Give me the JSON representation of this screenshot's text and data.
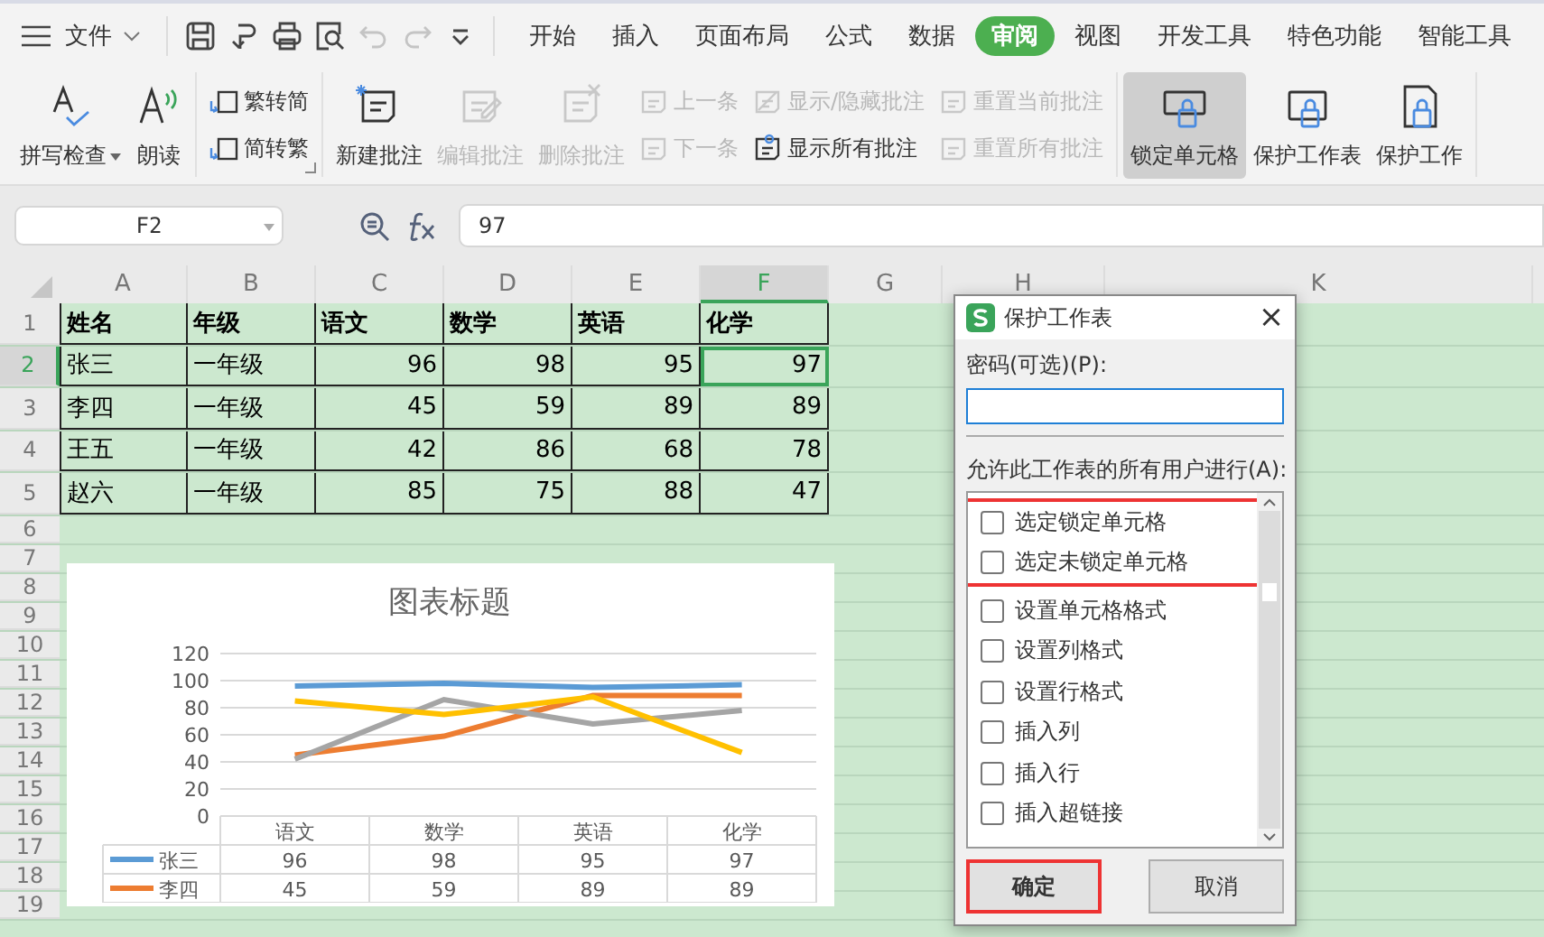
{
  "menu": {
    "label": "文件"
  },
  "quick_access": [
    {
      "disabled": false
    },
    {
      "disabled": false
    },
    {
      "disabled": false
    },
    {
      "disabled": false
    },
    {
      "disabled": true
    },
    {
      "disabled": true
    },
    {
      "disabled": false
    }
  ],
  "tabs": [
    {
      "label": "开始",
      "selected": false
    },
    {
      "label": "插入",
      "selected": false
    },
    {
      "label": "页面布局",
      "selected": false
    },
    {
      "label": "公式",
      "selected": false
    },
    {
      "label": "数据",
      "selected": false
    },
    {
      "label": "审阅",
      "selected": true
    },
    {
      "label": "视图",
      "selected": false
    },
    {
      "label": "开发工具",
      "selected": false
    },
    {
      "label": "特色功能",
      "selected": false
    },
    {
      "label": "智能工具",
      "selected": false
    }
  ],
  "ribbon": [
    {
      "controls": [
        {
          "kind": "large",
          "label": "拼写检查",
          "dropdown": true,
          "disabled": false,
          "pressed": false
        },
        {
          "kind": "large",
          "label": "朗读",
          "dropdown": false,
          "disabled": false,
          "pressed": false
        }
      ]
    },
    {
      "controls": [
        {
          "kind": "stack",
          "buttons": [
            {
              "label": "繁转简",
              "disabled": false
            },
            {
              "label": "简转繁",
              "disabled": false
            }
          ]
        }
      ]
    },
    {
      "controls": [
        {
          "kind": "large",
          "label": "新建批注",
          "dropdown": false,
          "disabled": false,
          "pressed": false
        },
        {
          "kind": "large",
          "label": "编辑批注",
          "dropdown": false,
          "disabled": true,
          "pressed": false
        },
        {
          "kind": "large",
          "label": "删除批注",
          "dropdown": false,
          "disabled": true,
          "pressed": false
        },
        {
          "kind": "stack",
          "buttons": [
            {
              "label": "上一条",
              "disabled": true
            },
            {
              "label": "下一条",
              "disabled": true
            }
          ]
        },
        {
          "kind": "stack",
          "buttons": [
            {
              "label": "显示/隐藏批注",
              "disabled": true
            },
            {
              "label": "显示所有批注",
              "disabled": false
            }
          ]
        },
        {
          "kind": "stack",
          "buttons": [
            {
              "label": "重置当前批注",
              "disabled": true
            },
            {
              "label": "重置所有批注",
              "disabled": true
            }
          ]
        }
      ]
    },
    {
      "controls": [
        {
          "kind": "large",
          "label": "锁定单元格",
          "dropdown": false,
          "disabled": false,
          "pressed": true
        },
        {
          "kind": "large",
          "label": "保护工作表",
          "dropdown": false,
          "disabled": false,
          "pressed": false
        },
        {
          "kind": "large",
          "label": "保护工作",
          "dropdown": false,
          "disabled": false,
          "pressed": false
        }
      ]
    }
  ],
  "formula_bar": {
    "name_box": "F2",
    "formula": "97"
  },
  "sheet": {
    "columns": [
      {
        "label": "A",
        "selected": false
      },
      {
        "label": "B",
        "selected": false
      },
      {
        "label": "C",
        "selected": false
      },
      {
        "label": "D",
        "selected": false
      },
      {
        "label": "E",
        "selected": false
      },
      {
        "label": "F",
        "selected": true
      },
      {
        "label": "G",
        "selected": false
      },
      {
        "label": "H",
        "selected": false
      },
      {
        "label": "K",
        "selected": false
      }
    ],
    "rows": [
      {
        "label": "1",
        "selected": false,
        "cells": [
          {
            "text": "姓名",
            "kind": "heading",
            "selected": false
          },
          {
            "text": "年级",
            "kind": "heading",
            "selected": false
          },
          {
            "text": "语文",
            "kind": "heading",
            "selected": false
          },
          {
            "text": "数学",
            "kind": "heading",
            "selected": false
          },
          {
            "text": "英语",
            "kind": "heading",
            "selected": false
          },
          {
            "text": "化学",
            "kind": "heading",
            "selected": false
          }
        ]
      },
      {
        "label": "2",
        "selected": true,
        "cells": [
          {
            "text": "张三",
            "kind": "text",
            "selected": false
          },
          {
            "text": "一年级",
            "kind": "text",
            "selected": false
          },
          {
            "text": "96",
            "kind": "number",
            "selected": false
          },
          {
            "text": "98",
            "kind": "number",
            "selected": false
          },
          {
            "text": "95",
            "kind": "number",
            "selected": false
          },
          {
            "text": "97",
            "kind": "number",
            "selected": true
          }
        ]
      },
      {
        "label": "3",
        "selected": false,
        "cells": [
          {
            "text": "李四",
            "kind": "text",
            "selected": false
          },
          {
            "text": "一年级",
            "kind": "text",
            "selected": false
          },
          {
            "text": "45",
            "kind": "number",
            "selected": false
          },
          {
            "text": "59",
            "kind": "number",
            "selected": false
          },
          {
            "text": "89",
            "kind": "number",
            "selected": false
          },
          {
            "text": "89",
            "kind": "number",
            "selected": false
          }
        ]
      },
      {
        "label": "4",
        "selected": false,
        "cells": [
          {
            "text": "王五",
            "kind": "text",
            "selected": false
          },
          {
            "text": "一年级",
            "kind": "text",
            "selected": false
          },
          {
            "text": "42",
            "kind": "number",
            "selected": false
          },
          {
            "text": "86",
            "kind": "number",
            "selected": false
          },
          {
            "text": "68",
            "kind": "number",
            "selected": false
          },
          {
            "text": "78",
            "kind": "number",
            "selected": false
          }
        ]
      },
      {
        "label": "5",
        "selected": false,
        "cells": [
          {
            "text": "赵六",
            "kind": "text",
            "selected": false
          },
          {
            "text": "一年级",
            "kind": "text",
            "selected": false
          },
          {
            "text": "85",
            "kind": "number",
            "selected": false
          },
          {
            "text": "75",
            "kind": "number",
            "selected": false
          },
          {
            "text": "88",
            "kind": "number",
            "selected": false
          },
          {
            "text": "47",
            "kind": "number",
            "selected": false
          }
        ]
      },
      {
        "label": "6",
        "selected": false
      },
      {
        "label": "7",
        "selected": false
      },
      {
        "label": "8",
        "selected": false
      },
      {
        "label": "9",
        "selected": false
      },
      {
        "label": "10",
        "selected": false
      },
      {
        "label": "11",
        "selected": false
      },
      {
        "label": "12",
        "selected": false
      },
      {
        "label": "13",
        "selected": false
      },
      {
        "label": "14",
        "selected": false
      },
      {
        "label": "15",
        "selected": false
      },
      {
        "label": "16",
        "selected": false
      },
      {
        "label": "17",
        "selected": false
      },
      {
        "label": "18",
        "selected": false
      },
      {
        "label": "19",
        "selected": false
      }
    ]
  },
  "chart": {
    "chart_data": {
      "type": "line",
      "title": "图表标题",
      "categories": [
        "语文",
        "数学",
        "英语",
        "化学"
      ],
      "series": [
        {
          "color": "#5b9bd5",
          "values": [
            96,
            98,
            95,
            97
          ]
        },
        {
          "color": "#ed7d31",
          "values": [
            45,
            59,
            89,
            89
          ]
        },
        {
          "color": "#a5a5a5",
          "values": [
            42,
            86,
            68,
            78
          ]
        },
        {
          "color": "#ffc000",
          "values": [
            85,
            75,
            88,
            47
          ]
        }
      ],
      "ylim": [
        0,
        120
      ],
      "yticks": [
        0,
        20,
        40,
        60,
        80,
        100,
        120
      ],
      "grid": true
    },
    "data_table": [
      {
        "name": "张三",
        "values": [
          "96",
          "98",
          "95",
          "97"
        ]
      },
      {
        "name": "李四",
        "values": [
          "45",
          "59",
          "89",
          "89"
        ]
      }
    ]
  },
  "dialog": {
    "title": "保护工作表",
    "close": "×",
    "password_label": "密码(可选)(P):",
    "permissions_label": "允许此工作表的所有用户进行(A):",
    "permission_groups": [
      {
        "highlighted": true,
        "items": [
          {
            "label": "选定锁定单元格",
            "checked": false
          },
          {
            "label": "选定未锁定单元格",
            "checked": false
          }
        ]
      },
      {
        "highlighted": false,
        "items": [
          {
            "label": "设置单元格格式",
            "checked": false
          },
          {
            "label": "设置列格式",
            "checked": false
          },
          {
            "label": "设置行格式",
            "checked": false
          },
          {
            "label": "插入列",
            "checked": false
          },
          {
            "label": "插入行",
            "checked": false
          },
          {
            "label": "插入超链接",
            "checked": false
          }
        ]
      }
    ],
    "buttons": [
      {
        "label": "确定",
        "highlighted": true
      },
      {
        "label": "取消",
        "highlighted": false
      }
    ]
  }
}
